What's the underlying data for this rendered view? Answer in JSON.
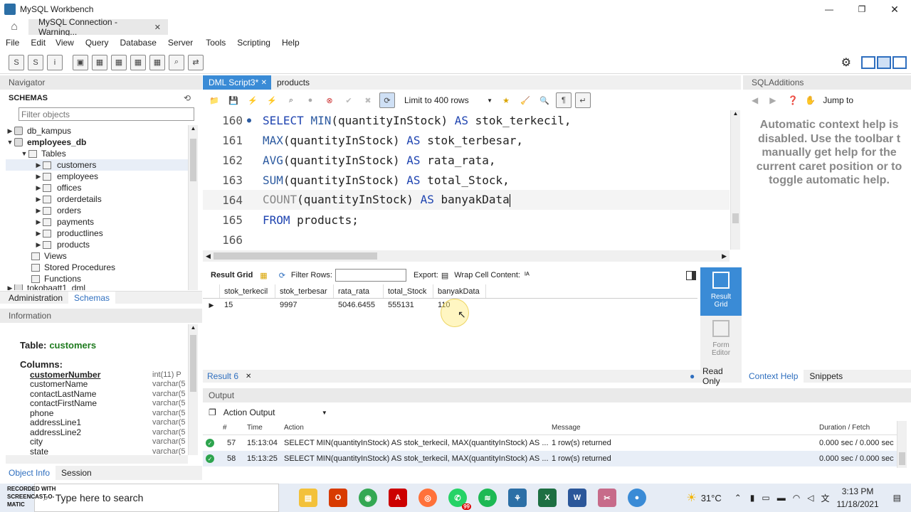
{
  "window": {
    "title": "MySQL Workbench"
  },
  "conn_tab": {
    "label": "MySQL Connection - Warning..."
  },
  "menu": [
    "File",
    "Edit",
    "View",
    "Query",
    "Database",
    "Server",
    "Tools",
    "Scripting",
    "Help"
  ],
  "navigator": {
    "title": "Navigator",
    "schemas_label": "SCHEMAS",
    "filter_placeholder": "Filter objects",
    "items": {
      "db1": "db_kampus",
      "db2": "employees_db",
      "tables": "Tables",
      "t1": "customers",
      "t2": "employees",
      "t3": "offices",
      "t4": "orderdetails",
      "t5": "orders",
      "t6": "payments",
      "t7": "productlines",
      "t8": "products",
      "views": "Views",
      "procs": "Stored Procedures",
      "funcs": "Functions",
      "db3": "tokobaatt1_dml"
    },
    "tab_admin": "Administration",
    "tab_schemas": "Schemas"
  },
  "info": {
    "title": "Information",
    "table_label": "Table:",
    "table_name": "customers",
    "columns_label": "Columns:",
    "columns": [
      {
        "name": "customerNumber",
        "type": "int(11) P"
      },
      {
        "name": "customerName",
        "type": "varchar(5"
      },
      {
        "name": "contactLastName",
        "type": "varchar(5"
      },
      {
        "name": "contactFirstName",
        "type": "varchar(5"
      },
      {
        "name": "phone",
        "type": "varchar(5"
      },
      {
        "name": "addressLine1",
        "type": "varchar(5"
      },
      {
        "name": "addressLine2",
        "type": "varchar(5"
      },
      {
        "name": "city",
        "type": "varchar(5"
      },
      {
        "name": "state",
        "type": "varchar(5"
      }
    ],
    "tab_object": "Object Info",
    "tab_session": "Session"
  },
  "editor": {
    "tab_active": "DML Script3*",
    "tab_other": "products",
    "limit_label": "Limit to 400 rows",
    "lines": [
      {
        "num": "160",
        "marker": "●",
        "p1": "SELECT ",
        "p2": "MIN",
        "p3": "(quantityInStock) ",
        "p4": "AS",
        "p5": " stok_terkecil,"
      },
      {
        "num": "161",
        "marker": "",
        "p1": "",
        "p2": "MAX",
        "p3": "(quantityInStock) ",
        "p4": "AS",
        "p5": " stok_terbesar,"
      },
      {
        "num": "162",
        "marker": "",
        "p1": "",
        "p2": "AVG",
        "p3": "(quantityInStock) ",
        "p4": "AS",
        "p5": " rata_rata,"
      },
      {
        "num": "163",
        "marker": "",
        "p1": "",
        "p2": "SUM",
        "p3": "(quantityInStock) ",
        "p4": "AS",
        "p5": " total_Stock,"
      },
      {
        "num": "164",
        "marker": "",
        "p1": "",
        "p2": "COUNT",
        "p3": "(quantityInStock) ",
        "p4": "AS",
        "p5": " banyakData"
      },
      {
        "num": "165",
        "marker": "",
        "p1": "FROM",
        "p2": "",
        "p3": " products;",
        "p4": "",
        "p5": ""
      },
      {
        "num": "166",
        "marker": "",
        "p1": "",
        "p2": "",
        "p3": "",
        "p4": "",
        "p5": ""
      }
    ]
  },
  "result": {
    "grid_label": "Result Grid",
    "filter_label": "Filter Rows:",
    "export_label": "Export:",
    "wrap_label": "Wrap Cell Content:",
    "columns": [
      "stok_terkecil",
      "stok_terbesar",
      "rata_rata",
      "total_Stock",
      "banyakData"
    ],
    "row": [
      "15",
      "9997",
      "5046.6455",
      "555131",
      "110"
    ],
    "side_result": "Result Grid",
    "side_form": "Form Editor",
    "tab_label": "Result 6",
    "read_only": "Read Only"
  },
  "sqladditions": {
    "title": "SQLAdditions",
    "jump_to": "Jump to",
    "help_text": "Automatic context help is disabled. Use the toolbar t manually get help for the current caret position or to toggle automatic help.",
    "tab_context": "Context Help",
    "tab_snippets": "Snippets"
  },
  "output": {
    "title": "Output",
    "selector": "Action Output",
    "headers": [
      "#",
      "Time",
      "Action",
      "Message",
      "Duration / Fetch"
    ],
    "rows": [
      {
        "num": "57",
        "time": "15:13:04",
        "action": "SELECT MIN(quantityInStock) AS stok_terkecil,  MAX(quantityInStock) AS ...",
        "message": "1 row(s) returned",
        "duration": "0.000 sec / 0.000 sec"
      },
      {
        "num": "58",
        "time": "15:13:25",
        "action": "SELECT MIN(quantityInStock) AS stok_terkecil,  MAX(quantityInStock) AS ...",
        "message": "1 row(s) returned",
        "duration": "0.000 sec / 0.000 sec"
      }
    ]
  },
  "taskbar": {
    "search": "Type here to search",
    "watermark": "RECORDED WITH SCREENCAST-O-MATIC",
    "temp": "31°C",
    "time": "3:13 PM",
    "date": "11/18/2021",
    "notif_count": "99"
  },
  "colors": {
    "accent": "#3a8bd6",
    "tab_active": "#3a8bd6",
    "ok_green": "#2da44e"
  }
}
